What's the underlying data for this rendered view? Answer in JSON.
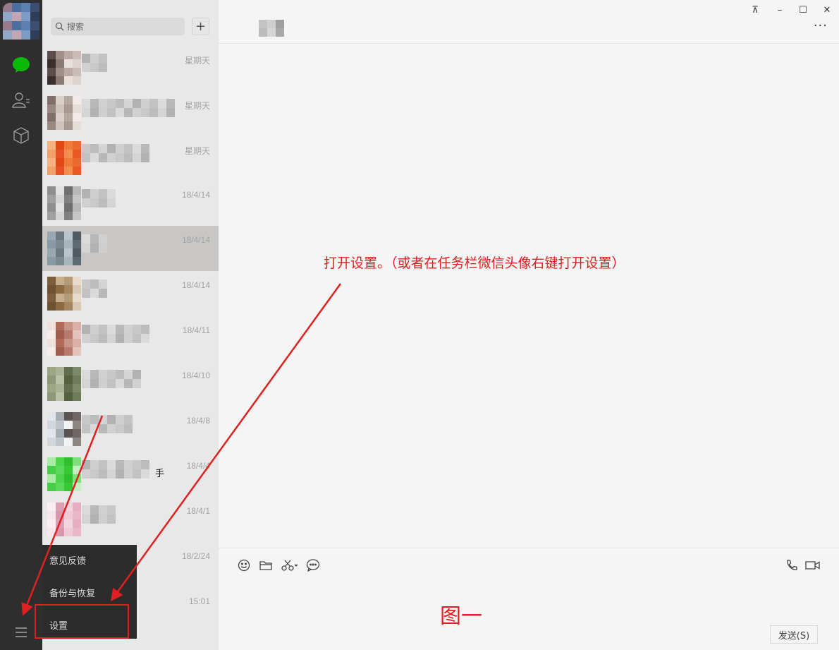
{
  "search": {
    "placeholder": "搜索"
  },
  "add_label": "+",
  "chats": [
    {
      "time": "星期天",
      "extra": ""
    },
    {
      "time": "星期天",
      "extra": ""
    },
    {
      "time": "星期天",
      "extra": ""
    },
    {
      "time": "18/4/14",
      "extra": ""
    },
    {
      "time": "18/4/14",
      "extra": ""
    },
    {
      "time": "18/4/14",
      "extra": ""
    },
    {
      "time": "18/4/11",
      "extra": ""
    },
    {
      "time": "18/4/10",
      "extra": ""
    },
    {
      "time": "18/4/8",
      "extra": ""
    },
    {
      "time": "18/4/4",
      "extra": "手"
    },
    {
      "time": "18/4/1",
      "extra": ""
    },
    {
      "time": "18/2/24",
      "extra": ""
    },
    {
      "time": "15:01",
      "extra": ""
    }
  ],
  "selected_chat_index": 4,
  "menu": {
    "items": [
      "意见反馈",
      "备份与恢复",
      "设置"
    ]
  },
  "window_controls": {
    "pin": "⊼",
    "minimize": "–",
    "maximize": "☐",
    "close": "✕"
  },
  "more_label": "···",
  "send_label": "发送(S)",
  "annotation": {
    "text": "打开设置。（或者在任务栏微信头像右键打开设置）",
    "figure_label": "图一"
  },
  "colors": {
    "accent_green": "#09bb07",
    "annotation_red": "#e02020",
    "sidebar": "#2e2e2e"
  },
  "icons": {
    "nav": [
      "chat-icon",
      "contacts-icon",
      "favorites-icon",
      "menu-icon"
    ],
    "tools": [
      "emoji-icon",
      "folder-icon",
      "scissors-icon",
      "chat-history-icon",
      "phone-icon",
      "video-icon"
    ]
  }
}
